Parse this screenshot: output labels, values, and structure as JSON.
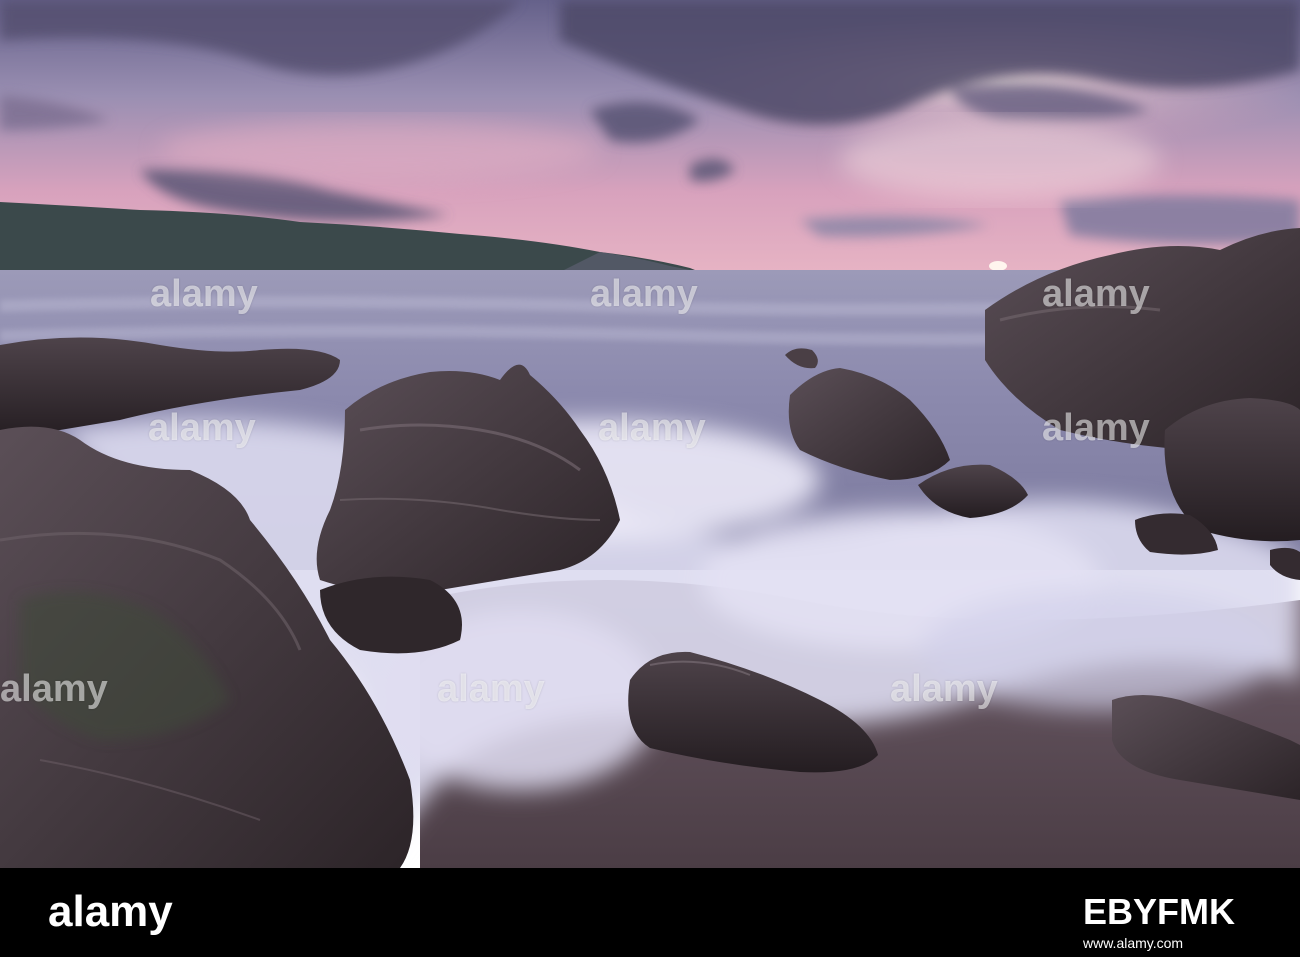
{
  "watermark": {
    "text": "alamy"
  },
  "footer": {
    "logo": "alamy",
    "image_id": "EBYFMK",
    "url": "www.alamy.com"
  },
  "palette": {
    "sky_top": "#6f6a8c",
    "sky_pink": "#e7a3b8",
    "cloud_dark": "#4f4c6a",
    "headland": "#3c4a4c",
    "sea": "#8f8fb0",
    "surf": "#dcdcf0",
    "rock": "#3a3236",
    "pebbles": "#5a4a50"
  }
}
